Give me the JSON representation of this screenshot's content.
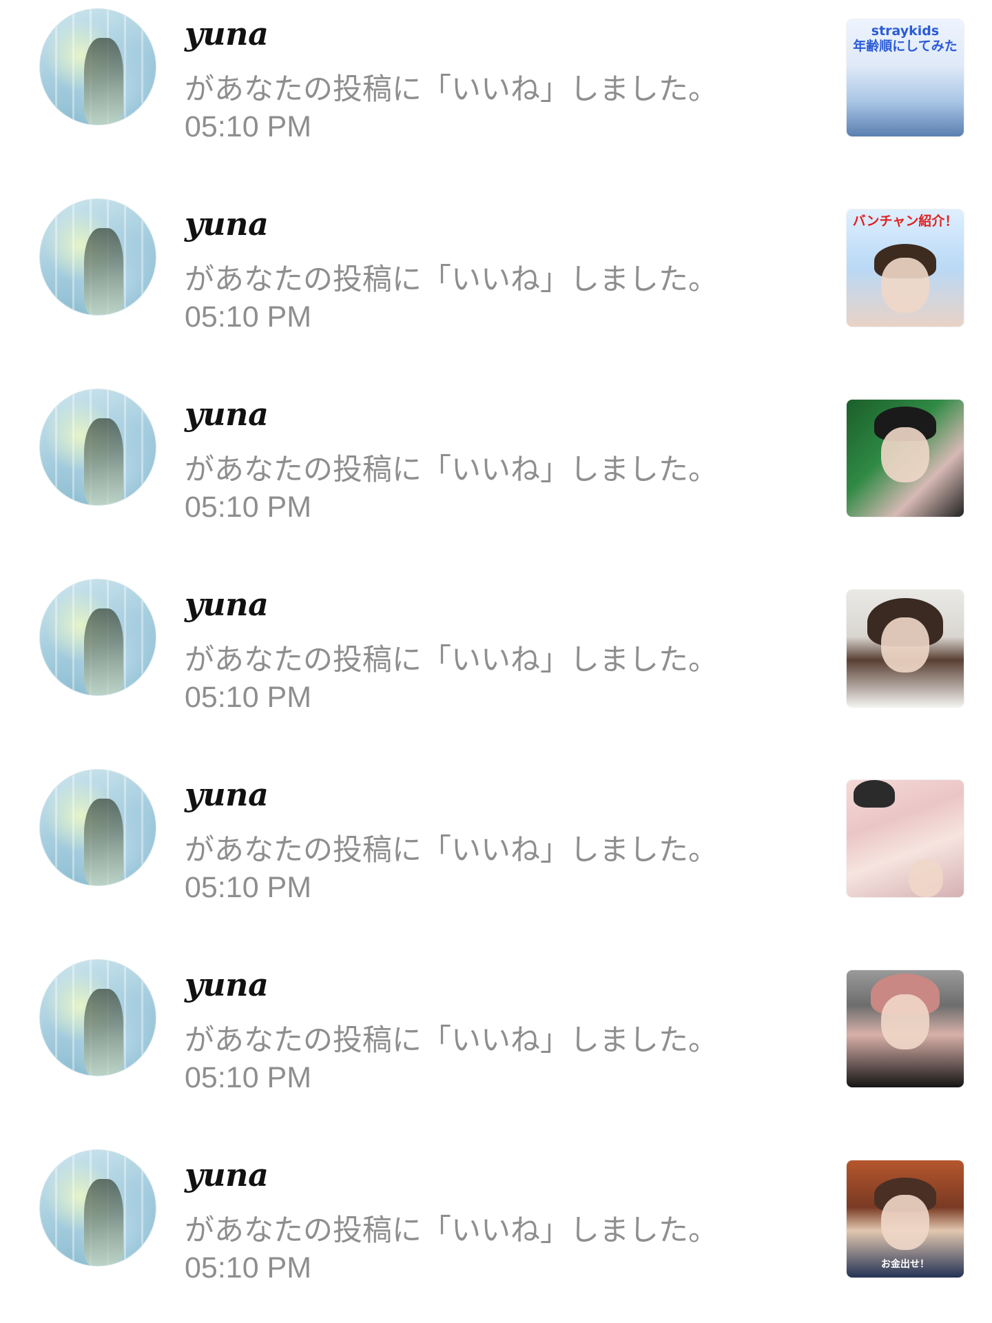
{
  "notifications": [
    {
      "username": "yuna",
      "message": "があなたの投稿に「いいね」しました。",
      "time": "05:10 PM",
      "thumb_caption": "straykids\n年齢順にしてみた"
    },
    {
      "username": "yuna",
      "message": "があなたの投稿に「いいね」しました。",
      "time": "05:10 PM",
      "thumb_caption": "バンチャン紹介！"
    },
    {
      "username": "yuna",
      "message": "があなたの投稿に「いいね」しました。",
      "time": "05:10 PM",
      "thumb_caption": ""
    },
    {
      "username": "yuna",
      "message": "があなたの投稿に「いいね」しました。",
      "time": "05:10 PM",
      "thumb_caption": ""
    },
    {
      "username": "yuna",
      "message": "があなたの投稿に「いいね」しました。",
      "time": "05:10 PM",
      "thumb_caption": ""
    },
    {
      "username": "yuna",
      "message": "があなたの投稿に「いいね」しました。",
      "time": "05:10 PM",
      "thumb_caption": ""
    },
    {
      "username": "yuna",
      "message": "があなたの投稿に「いいね」しました。",
      "time": "05:10 PM",
      "thumb_caption": "お金出せ！"
    }
  ],
  "colors": {
    "username": "#111111",
    "secondary_text": "#8e8e8e",
    "background": "#ffffff"
  },
  "icons": {
    "avatar": "user-avatar-image",
    "thumbnail": "post-thumbnail-image"
  }
}
